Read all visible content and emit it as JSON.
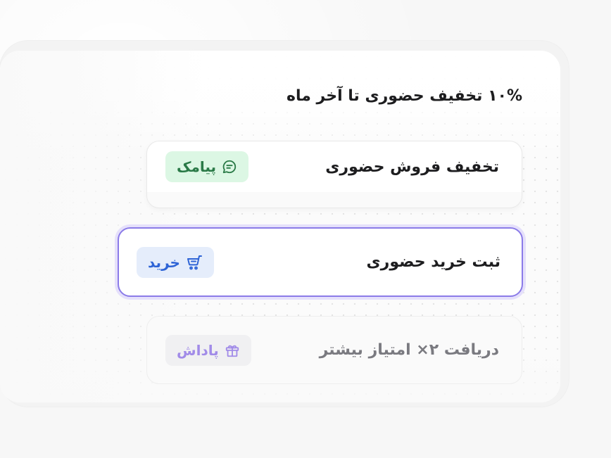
{
  "heading": "۱۰% تخفیف حضوری تا آخر ماه",
  "rows": [
    {
      "label": "تخفیف فروش حضوری",
      "badge": {
        "label": "پیامک",
        "icon": "message-icon",
        "color": "#2a7a47"
      }
    },
    {
      "label": "ثبت خرید حضوری",
      "badge": {
        "label": "خرید",
        "icon": "cart-icon",
        "color": "#2e64d6"
      },
      "selected": true
    },
    {
      "label": "دریافت ۲× امتیاز بیشتر",
      "badge": {
        "label": "پاداش",
        "icon": "gift-icon",
        "color": "#a18be8"
      }
    }
  ],
  "colors": {
    "selected_border": "#8b7be8",
    "sms_badge_bg": "#dcf7e4",
    "buy_badge_bg": "#e5edfb",
    "reward_badge_bg": "#f0f0f2"
  }
}
